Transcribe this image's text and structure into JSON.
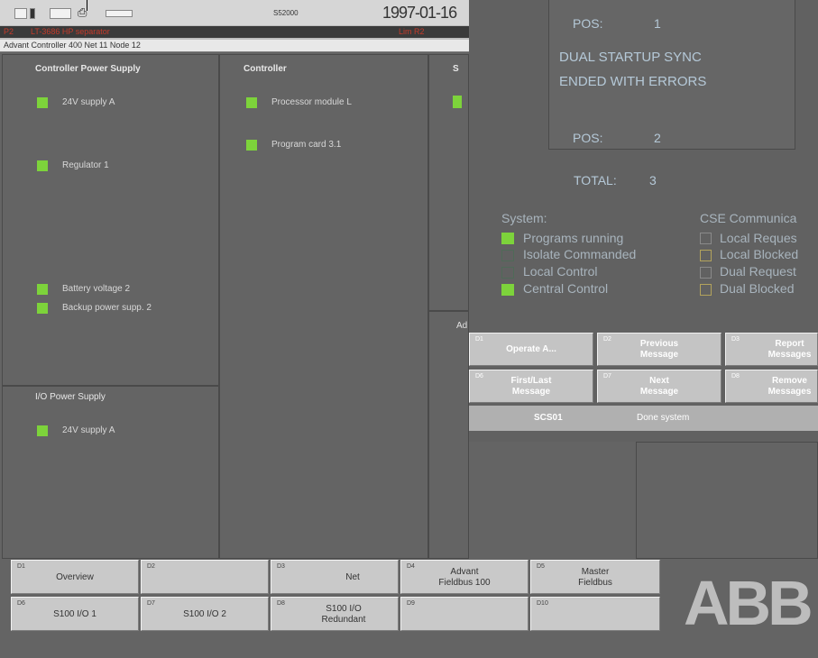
{
  "topbar": {
    "code": "S52000",
    "date": "1997-01-16",
    "alarm_prefix": "P2",
    "alarm_text": "LT-3686 HP separator",
    "alarm_tag": "Lim R2",
    "info": "Advant Controller 400   Net 11  Node 12"
  },
  "panels": {
    "power": {
      "title": "Controller Power Supply",
      "items": [
        "24V supply A",
        "Regulator 1",
        "Battery voltage 2",
        "Backup power supp. 2"
      ]
    },
    "controller": {
      "title": "Controller",
      "items": [
        "Processor module L",
        "Program card 3.1"
      ]
    },
    "third": {
      "title_fragment": "S"
    },
    "io_power": {
      "title": "I/O Power Supply",
      "items": [
        "24V supply A"
      ]
    },
    "lower_fragment": "Ad"
  },
  "message": {
    "pos1_label": "POS:",
    "pos1_value": "1",
    "line1": "DUAL STARTUP SYNC",
    "line2": "ENDED WITH ERRORS",
    "pos2_label": "POS:",
    "pos2_value": "2",
    "total_label": "TOTAL:",
    "total_value": "3",
    "system_title": "System:",
    "system_items": [
      {
        "label": "Programs running",
        "on": true
      },
      {
        "label": "Isolate Commanded",
        "on": false
      },
      {
        "label": "Local Control",
        "on": false
      },
      {
        "label": "Central Control",
        "on": true
      }
    ],
    "cse_title": "CSE Communica",
    "cse_items": [
      "Local Reques",
      "Local Blocked",
      "Dual Request",
      "Dual Blocked"
    ],
    "buttons": [
      {
        "key": "D1",
        "label": "Operate A..."
      },
      {
        "key": "D2",
        "label": "Previous\nMessage"
      },
      {
        "key": "D3",
        "label": "Report\nMessages"
      },
      {
        "key": "D6",
        "label": "First/Last\nMessage"
      },
      {
        "key": "D7",
        "label": "Next\nMessage"
      },
      {
        "key": "D8",
        "label": "Remove\nMessages"
      }
    ],
    "footer_left": "SCS01",
    "footer_right": "Done system"
  },
  "fkeys": [
    {
      "key": "D1",
      "label": "Overview"
    },
    {
      "key": "D2",
      "label": ""
    },
    {
      "key": "D3",
      "label": "Net"
    },
    {
      "key": "D4",
      "label": "Advant\nFieldbus 100"
    },
    {
      "key": "D5",
      "label": "Master\nFieldbus"
    },
    {
      "key": "D6",
      "label": "S100 I/O 1"
    },
    {
      "key": "D7",
      "label": "S100 I/O 2"
    },
    {
      "key": "D8",
      "label": "S100 I/O\nRedundant"
    },
    {
      "key": "D9",
      "label": ""
    },
    {
      "key": "D10",
      "label": ""
    }
  ],
  "logo": "ABB",
  "colors": {
    "led_on": "#7dd33b",
    "alarm": "#c43a2a",
    "message_text": "#b5c9d8"
  }
}
